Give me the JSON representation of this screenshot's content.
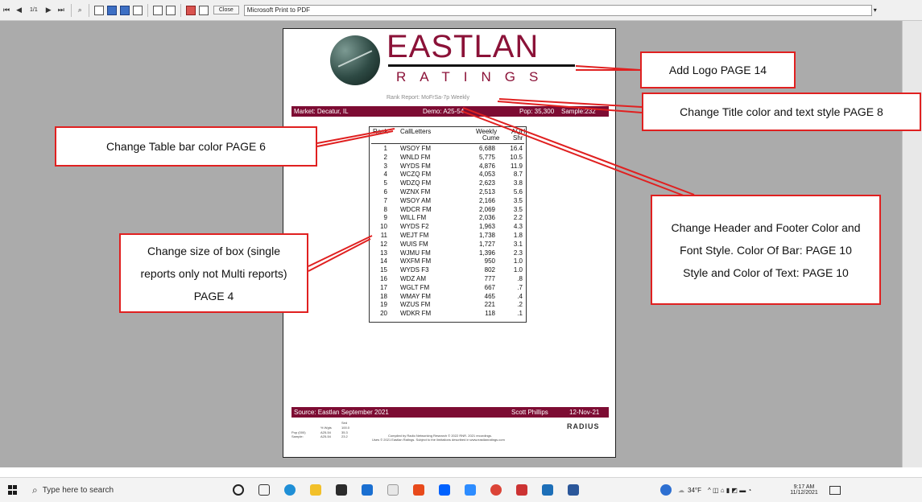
{
  "toolbar": {
    "page_indicator": "1/1",
    "close_label": "Close",
    "printer_name": "Microsoft Print to PDF"
  },
  "report": {
    "logo_title": "EASTLAN",
    "logo_sub": "RATINGS",
    "rank_report_line": "Rank Report: MoFrSa-7p Weekly",
    "header": {
      "market": "Market: Decatur, IL",
      "demo": "Demo: A25-54",
      "pop": "Pop: 35,300",
      "sample": "Sample:232"
    },
    "table": {
      "headers": {
        "rank": "Rank",
        "call": "CallLetters",
        "weekly": "Weekly",
        "cume": "Cume",
        "aqh": "AQH",
        "shr": "Shr"
      },
      "rows": [
        {
          "rank": "1",
          "call": "WSOY FM",
          "cume": "6,688",
          "shr": "16.4"
        },
        {
          "rank": "2",
          "call": "WNLD FM",
          "cume": "5,775",
          "shr": "10.5"
        },
        {
          "rank": "3",
          "call": "WYDS FM",
          "cume": "4,876",
          "shr": "11.9"
        },
        {
          "rank": "4",
          "call": "WCZQ FM",
          "cume": "4,053",
          "shr": "8.7"
        },
        {
          "rank": "5",
          "call": "WDZQ FM",
          "cume": "2,623",
          "shr": "3.8"
        },
        {
          "rank": "6",
          "call": "WZNX FM",
          "cume": "2,513",
          "shr": "5.6"
        },
        {
          "rank": "7",
          "call": "WSOY AM",
          "cume": "2,166",
          "shr": "3.5"
        },
        {
          "rank": "8",
          "call": "WDCR FM",
          "cume": "2,069",
          "shr": "3.5"
        },
        {
          "rank": "9",
          "call": "WILL FM",
          "cume": "2,036",
          "shr": "2.2"
        },
        {
          "rank": "10",
          "call": "WYDS F2",
          "cume": "1,963",
          "shr": "4.3"
        },
        {
          "rank": "11",
          "call": "WEJT FM",
          "cume": "1,738",
          "shr": "1.8"
        },
        {
          "rank": "12",
          "call": "WUIS FM",
          "cume": "1,727",
          "shr": "3.1"
        },
        {
          "rank": "13",
          "call": "WJMU FM",
          "cume": "1,396",
          "shr": "2.3"
        },
        {
          "rank": "14",
          "call": "WXFM FM",
          "cume": "950",
          "shr": "1.0"
        },
        {
          "rank": "15",
          "call": "WYDS F3",
          "cume": "802",
          "shr": "1.0"
        },
        {
          "rank": "16",
          "call": "WDZ AM",
          "cume": "777",
          "shr": ".8"
        },
        {
          "rank": "17",
          "call": "WGLT FM",
          "cume": "667",
          "shr": ".7"
        },
        {
          "rank": "18",
          "call": "WMAY FM",
          "cume": "465",
          "shr": ".4"
        },
        {
          "rank": "19",
          "call": "WZUS FM",
          "cume": "221",
          "shr": ".2"
        },
        {
          "rank": "20",
          "call": "WDKR FM",
          "cume": "118",
          "shr": ".1"
        }
      ]
    },
    "footer": {
      "source": "Source: Eastlan September 2021",
      "name": "Scott Phillips",
      "date": "12-Nov-21"
    },
    "fine_print": {
      "col1_a": "Pop (000)",
      "col1_b": "Sample:",
      "col2_a": "% Wgts",
      "col2_b": "A25-54",
      "col2_c": "A25-54",
      "col3_a": "Sed",
      "col3_b": "100.0",
      "col3_c": "35.3",
      "col3_d": "23.2",
      "line1": "Compiled by Radio Networking Research © 2022 RNR. 2021 recordings.",
      "line2": "Uses © 2021 Eastlan Ratings. Subject to the limitations described in www.eastlanratings.com"
    },
    "radius_logo": "RADIUS"
  },
  "callouts": {
    "logo": "Add Logo PAGE 14",
    "title": "Change Title color and text style PAGE 8",
    "table_bar": "Change Table bar color PAGE 6",
    "header_footer": "Change Header and Footer Color and Font Style. Color Of Bar: PAGE 10  Style and Color of Text: PAGE 10",
    "box_size": "Change size of box (single reports only not Multi reports) PAGE 4"
  },
  "taskbar": {
    "search_placeholder": "Type here to search",
    "temperature": "34°F",
    "time": "9:17 AM",
    "date": "11/12/2021"
  },
  "colors": {
    "brand_maroon": "#7d0c33",
    "callout_red": "#e02020"
  }
}
